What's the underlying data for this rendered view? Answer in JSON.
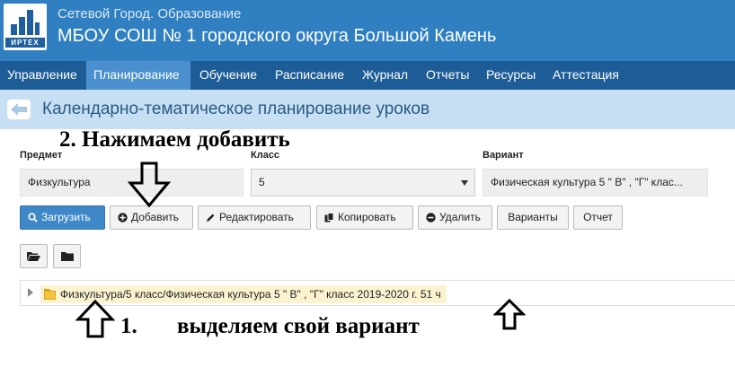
{
  "header": {
    "logo_text": "ИРТЕХ",
    "app_title": "Сетевой Город. Образование",
    "school_name": "МБОУ СОШ № 1 городского округа Большой Камень"
  },
  "nav": {
    "items": [
      "Управление",
      "Планирование",
      "Обучение",
      "Расписание",
      "Журнал",
      "Отчеты",
      "Ресурсы",
      "Аттестация"
    ],
    "active": "Планирование"
  },
  "page": {
    "title": "Календарно-тематическое планирование уроков"
  },
  "annotations": {
    "step2": "2. Нажимаем добавить",
    "step1_number": "1.",
    "step1_text": "выделяем свой вариант"
  },
  "form": {
    "subject_label": "Предмет",
    "subject_value": "Физкультура",
    "class_label": "Класс",
    "class_value": "5",
    "variant_label": "Вариант",
    "variant_value": "Физическая культура 5 \" В\" , \"Г\" клас..."
  },
  "toolbar": {
    "load": "Загрузить",
    "add": "Добавить",
    "edit": "Редактировать",
    "copy": "Копировать",
    "delete": "Удалить",
    "variants": "Варианты",
    "report": "Отчет"
  },
  "tree": {
    "node_label": "Физкультура/5 класс/Физическая культура 5 \" В\" , \"Г\" класс 2019-2020 г. 51 ч"
  },
  "colors": {
    "header": "#2f7fc1",
    "nav": "#1d5c96",
    "nav_active": "#4a90cf",
    "title_bar": "#c7dff2",
    "primary_button": "#3f88c8",
    "selected_node": "#fbf3d0"
  },
  "icons": [
    "logo-icon",
    "back-arrow-icon",
    "search-icon",
    "plus-circle-icon",
    "pencil-icon",
    "copy-icon",
    "minus-circle-icon",
    "folder-open-icon",
    "folder-icon",
    "caret-down-icon",
    "tree-expand-icon"
  ]
}
